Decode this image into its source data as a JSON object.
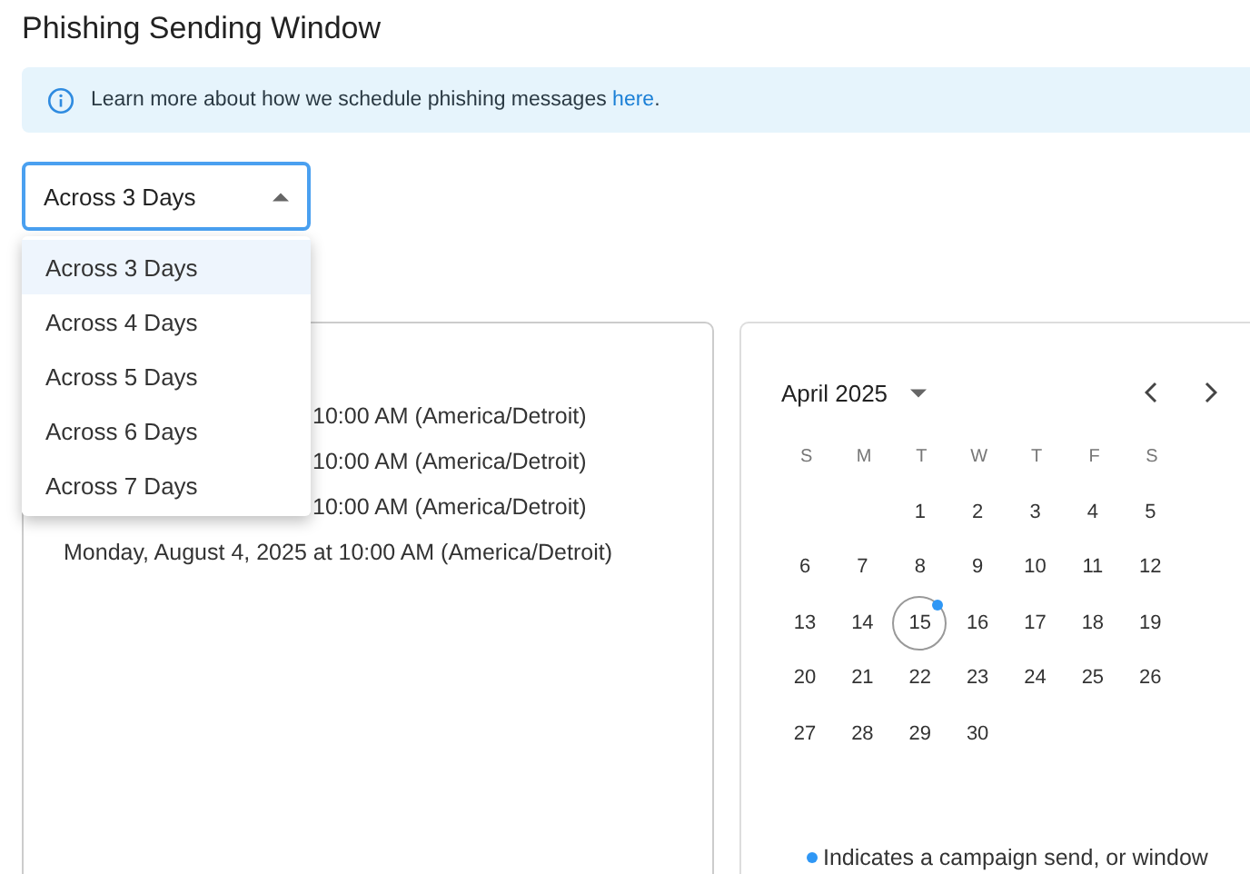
{
  "title": "Phishing Sending Window",
  "info": {
    "text": "Learn more about how we schedule phishing messages",
    "link": "here",
    "end": "."
  },
  "select": {
    "value": "Across 3 Days",
    "expanded": true
  },
  "options": [
    {
      "label": "Across 3 Days",
      "selected": true
    },
    {
      "label": "Across 4 Days",
      "selected": false
    },
    {
      "label": "Across 5 Days",
      "selected": false
    },
    {
      "label": "Across 6 Days",
      "selected": false
    },
    {
      "label": "Across 7 Days",
      "selected": false
    }
  ],
  "schedule": [
    {
      "text": "10:00 AM (America/Detroit)",
      "partial": true
    },
    {
      "text": "10:00 AM (America/Detroit)",
      "partial": true
    },
    {
      "text": "10:00 AM (America/Detroit)",
      "partial": true
    },
    {
      "text": "Monday, August 4, 2025 at 10:00 AM (America/Detroit)",
      "partial": false
    }
  ],
  "calendar": {
    "month": "April 2025",
    "weekdays": [
      "S",
      "M",
      "T",
      "W",
      "T",
      "F",
      "S"
    ],
    "weeks": [
      [
        {
          "day": "1",
          "today": false,
          "event": false
        },
        {
          "day": "2",
          "today": false,
          "event": false
        },
        {
          "day": "3",
          "today": false,
          "event": false
        },
        {
          "day": "4",
          "today": false,
          "event": false
        },
        {
          "day": "5",
          "today": false,
          "event": false
        }
      ],
      [
        {
          "day": "6",
          "today": false,
          "event": false
        },
        {
          "day": "7",
          "today": false,
          "event": false
        },
        {
          "day": "8",
          "today": false,
          "event": false
        },
        {
          "day": "9",
          "today": false,
          "event": false
        },
        {
          "day": "10",
          "today": false,
          "event": false
        },
        {
          "day": "11",
          "today": false,
          "event": false
        },
        {
          "day": "12",
          "today": false,
          "event": false
        }
      ],
      [
        {
          "day": "13",
          "today": false,
          "event": false
        },
        {
          "day": "14",
          "today": false,
          "event": false
        },
        {
          "day": "15",
          "today": true,
          "event": true
        },
        {
          "day": "16",
          "today": false,
          "event": false
        },
        {
          "day": "17",
          "today": false,
          "event": false
        },
        {
          "day": "18",
          "today": false,
          "event": false
        },
        {
          "day": "19",
          "today": false,
          "event": false
        }
      ],
      [
        {
          "day": "20",
          "today": false,
          "event": false
        },
        {
          "day": "21",
          "today": false,
          "event": false
        },
        {
          "day": "22",
          "today": false,
          "event": false
        },
        {
          "day": "23",
          "today": false,
          "event": false
        },
        {
          "day": "24",
          "today": false,
          "event": false
        },
        {
          "day": "25",
          "today": false,
          "event": false
        },
        {
          "day": "26",
          "today": false,
          "event": false
        }
      ],
      [
        {
          "day": "27",
          "today": false,
          "event": false
        },
        {
          "day": "28",
          "today": false,
          "event": false
        },
        {
          "day": "29",
          "today": false,
          "event": false
        },
        {
          "day": "30",
          "today": false,
          "event": false
        }
      ]
    ],
    "legend": "Indicates a campaign send, or window"
  }
}
